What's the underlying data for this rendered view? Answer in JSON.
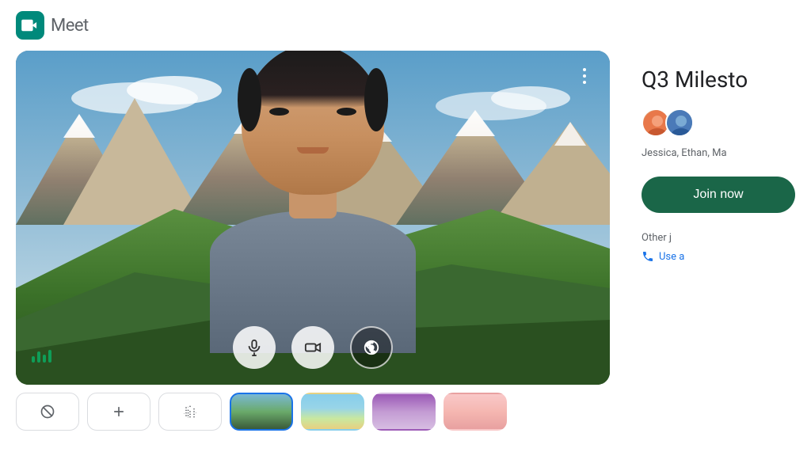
{
  "header": {
    "logo_text": "Meet"
  },
  "video": {
    "more_menu_label": "More options"
  },
  "controls": {
    "mic_label": "Microphone",
    "camera_label": "Camera",
    "effects_label": "Visual effects"
  },
  "bottom_strip": {
    "none_label": "None",
    "add_label": "Add",
    "blur_label": "Blur"
  },
  "right_panel": {
    "meeting_title": "Q3 Milesto",
    "participants_text": "Jessica, Ethan, Ma",
    "join_button_label": "Join now",
    "other_join_text": "Other j",
    "use_audio_text": "Use a"
  }
}
